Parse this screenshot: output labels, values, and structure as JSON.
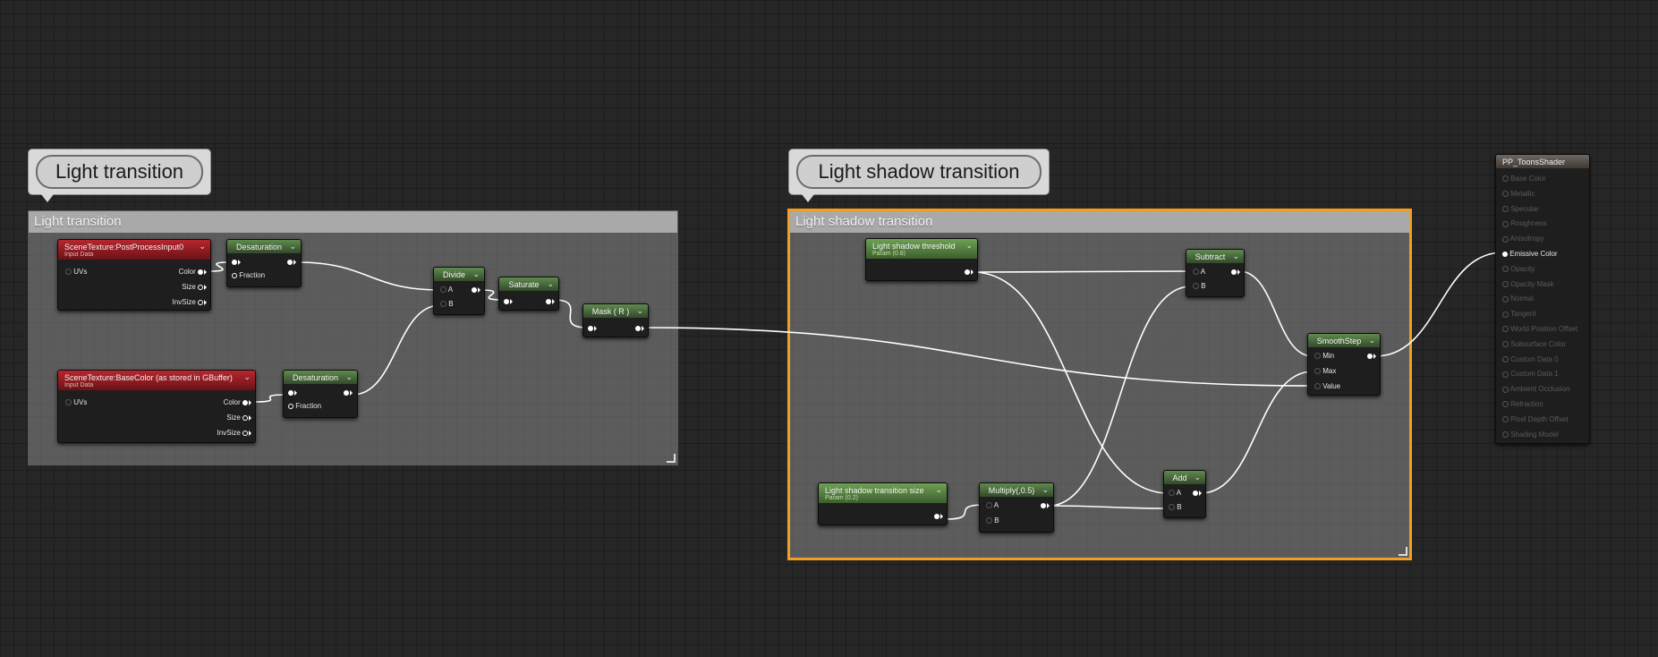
{
  "bubbles": {
    "light": "Light transition",
    "shadow": "Light shadow transition"
  },
  "comments": {
    "light": "Light transition",
    "shadow": "Light shadow transition"
  },
  "nodes": {
    "scene_pp": {
      "title": "SceneTexture:PostProcessInput0",
      "subtitle": "Input Data",
      "in_uvs": "UVs",
      "out_color": "Color",
      "out_size": "Size",
      "out_invsize": "InvSize"
    },
    "scene_base": {
      "title": "SceneTexture:BaseColor (as stored in GBuffer)",
      "subtitle": "Input Data",
      "in_uvs": "UVs",
      "out_color": "Color",
      "out_size": "Size",
      "out_invsize": "InvSize"
    },
    "desat1": {
      "title": "Desaturation",
      "fraction": "Fraction"
    },
    "desat2": {
      "title": "Desaturation",
      "fraction": "Fraction"
    },
    "divide": {
      "title": "Divide",
      "a": "A",
      "b": "B"
    },
    "saturate": {
      "title": "Saturate"
    },
    "mask": {
      "title": "Mask ( R )"
    },
    "threshold": {
      "title": "Light shadow threshold",
      "subtitle": "Param (0.8)"
    },
    "trans_size": {
      "title": "Light shadow transition size",
      "subtitle": "Param (0.2)"
    },
    "multiply": {
      "title": "Multiply(,0.5)",
      "a": "A",
      "b": "B"
    },
    "subtract": {
      "title": "Subtract",
      "a": "A",
      "b": "B"
    },
    "add": {
      "title": "Add",
      "a": "A",
      "b": "B"
    },
    "smoothstep": {
      "title": "SmoothStep",
      "min": "Min",
      "max": "Max",
      "value": "Value"
    },
    "output": {
      "title": "PP_ToonsShader",
      "pins": [
        "Base Color",
        "Metallic",
        "Specular",
        "Roughness",
        "Anisotropy",
        "Emissive Color",
        "Opacity",
        "Opacity Mask",
        "Normal",
        "Tangent",
        "World Position Offset",
        "Subsurface Color",
        "Custom Data 0",
        "Custom Data 1",
        "Ambient Occlusion",
        "Refraction",
        "Pixel Depth Offset",
        "Shading Model"
      ],
      "active_pin": "Emissive Color"
    }
  },
  "colors": {
    "selection": "#f0a020",
    "wire": "#ffffff",
    "material_node": "#6a9a54",
    "scene_texture": "#b3232b"
  }
}
